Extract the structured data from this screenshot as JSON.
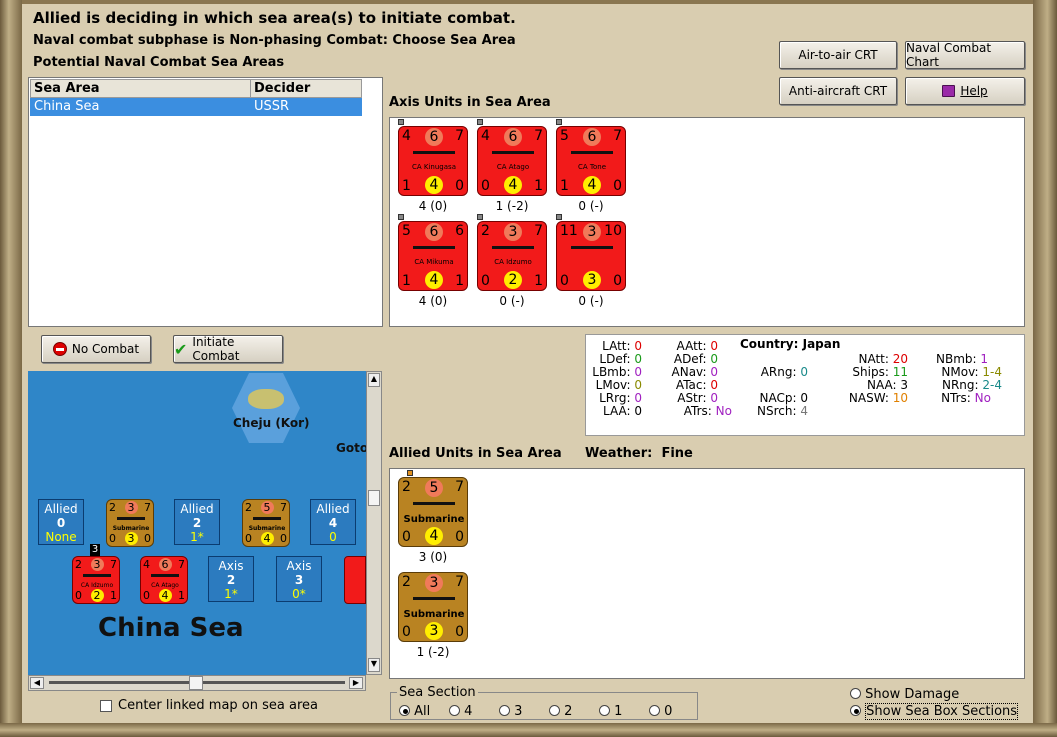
{
  "header": {
    "title": "Allied is deciding in which sea area(s) to initiate combat.",
    "subphase": "Naval combat subphase is Non-phasing Combat: Choose Sea Area",
    "list_title": "Potential Naval Combat Sea Areas"
  },
  "buttons": {
    "air_to_air": "Air-to-air CRT",
    "naval_chart": "Naval Combat Chart",
    "anti_aircraft": "Anti-aircraft CRT",
    "help": "Help",
    "no_combat": "No Combat",
    "initiate_combat": "Initiate Combat"
  },
  "sea_table": {
    "headers": [
      "Sea Area",
      "Decider"
    ],
    "rows": [
      [
        "China Sea",
        "USSR"
      ]
    ]
  },
  "axis_section": {
    "title": "Axis Units in Sea Area",
    "units": [
      {
        "tl": "4",
        "tc": "6",
        "tr": "7",
        "name": "CA Kinugasa",
        "bl": "1",
        "bc": "4",
        "br": "0",
        "cap": "4 (0)"
      },
      {
        "tl": "4",
        "tc": "6",
        "tr": "7",
        "name": "CA Atago",
        "bl": "0",
        "bc": "4",
        "br": "1",
        "cap": "1 (-2)"
      },
      {
        "tl": "5",
        "tc": "6",
        "tr": "7",
        "name": "CA Tone",
        "bl": "1",
        "bc": "4",
        "br": "0",
        "cap": "0 (-)"
      },
      {
        "tl": "5",
        "tc": "6",
        "tr": "6",
        "name": "CA Mikuma",
        "bl": "1",
        "bc": "4",
        "br": "1",
        "cap": "4 (0)"
      },
      {
        "tl": "2",
        "tc": "3",
        "tr": "7",
        "name": "CA Idzumo",
        "bl": "0",
        "bc": "2",
        "br": "1",
        "cap": "0 (-)"
      },
      {
        "tl": "11",
        "tc": "3",
        "tr": "10",
        "name": "",
        "bl": "0",
        "bc": "3",
        "br": "0",
        "cap": "0 (-)"
      }
    ]
  },
  "stats": {
    "country_label": "Country:",
    "country": "Japan",
    "LAtt": "0",
    "LDef": "0",
    "LBmb": "0",
    "LMov": "0",
    "LRrg": "0",
    "LAA": "0",
    "AAtt": "0",
    "ADef": "0",
    "ANav": "0",
    "ATac": "0",
    "AStr": "0",
    "ATrs": "No",
    "ARng": "0",
    "NACp": "0",
    "NSrch": "4",
    "NAtt": "20",
    "Ships": "11",
    "NAA": "3",
    "NASW": "10",
    "NBmb": "1",
    "NMov": "1-4",
    "NRng": "2-4",
    "NTrs": "No"
  },
  "allied_section": {
    "title": "Allied Units in Sea Area",
    "weather_label": "Weather:",
    "weather": "Fine",
    "units": [
      {
        "tl": "2",
        "tc": "5",
        "tr": "7",
        "name": "Submarine",
        "bl": "0",
        "bc": "4",
        "br": "0",
        "cap": "3 (0)"
      },
      {
        "tl": "2",
        "tc": "3",
        "tr": "7",
        "name": "Submarine",
        "bl": "0",
        "bc": "3",
        "br": "0",
        "cap": "1 (-2)"
      }
    ]
  },
  "map": {
    "island": "Cheju (Kor)",
    "goto": "Goto",
    "area_name": "China Sea",
    "allied_boxes": [
      {
        "label": "Allied",
        "num": "0",
        "sub": "None"
      },
      {
        "label": "Allied",
        "num": "2",
        "sub": "1*"
      },
      {
        "label": "Allied",
        "num": "4",
        "sub": "0"
      }
    ],
    "axis_boxes": [
      {
        "label": "Axis",
        "num": "2",
        "sub": "1*"
      },
      {
        "label": "Axis",
        "num": "3",
        "sub": "0*"
      }
    ],
    "map_counters": [
      {
        "tl": "2",
        "tc": "3",
        "tr": "7",
        "name": "Submarine",
        "bl": "0",
        "bc": "3",
        "br": "0"
      },
      {
        "tl": "2",
        "tc": "5",
        "tr": "7",
        "name": "Submarine",
        "bl": "0",
        "bc": "4",
        "br": "0"
      },
      {
        "tl": "2",
        "tc": "3",
        "tr": "7",
        "name": "CA Idzumo",
        "bl": "0",
        "bc": "2",
        "br": "1"
      },
      {
        "tl": "4",
        "tc": "6",
        "tr": "7",
        "name": "CA Atago",
        "bl": "0",
        "bc": "4",
        "br": "1"
      }
    ],
    "stack_badge": "3",
    "center_linked_label": "Center linked map on sea area"
  },
  "sea_section": {
    "label": "Sea Section",
    "options": [
      "All",
      "4",
      "3",
      "2",
      "1",
      "0"
    ],
    "selected": "All"
  },
  "display_options": {
    "show_damage": "Show Damage",
    "show_sea_box": "Show Sea Box Sections",
    "selected": "Show Sea Box Sections"
  },
  "colors": {
    "axis_counter": "#f21a1a",
    "allied_counter": "#b98322",
    "selection": "#3b8ee0",
    "sea": "#2f86c8"
  }
}
